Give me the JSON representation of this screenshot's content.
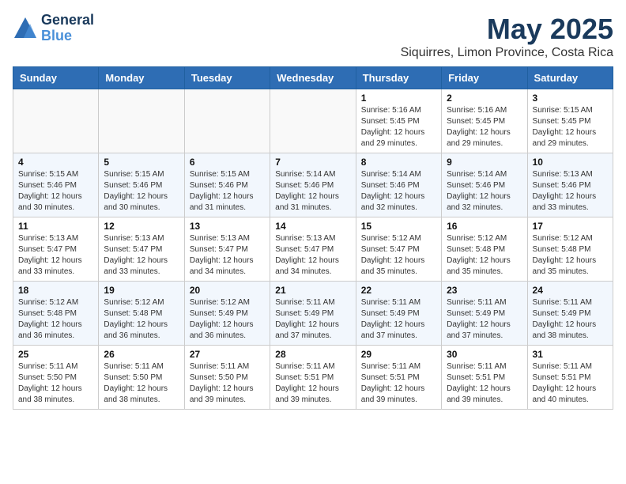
{
  "header": {
    "logo_general": "General",
    "logo_blue": "Blue",
    "month_title": "May 2025",
    "location": "Siquirres, Limon Province, Costa Rica"
  },
  "weekdays": [
    "Sunday",
    "Monday",
    "Tuesday",
    "Wednesday",
    "Thursday",
    "Friday",
    "Saturday"
  ],
  "weeks": [
    [
      {
        "day": "",
        "sunrise": "",
        "sunset": "",
        "daylight": ""
      },
      {
        "day": "",
        "sunrise": "",
        "sunset": "",
        "daylight": ""
      },
      {
        "day": "",
        "sunrise": "",
        "sunset": "",
        "daylight": ""
      },
      {
        "day": "",
        "sunrise": "",
        "sunset": "",
        "daylight": ""
      },
      {
        "day": "1",
        "sunrise": "Sunrise: 5:16 AM",
        "sunset": "Sunset: 5:45 PM",
        "daylight": "Daylight: 12 hours and 29 minutes."
      },
      {
        "day": "2",
        "sunrise": "Sunrise: 5:16 AM",
        "sunset": "Sunset: 5:45 PM",
        "daylight": "Daylight: 12 hours and 29 minutes."
      },
      {
        "day": "3",
        "sunrise": "Sunrise: 5:15 AM",
        "sunset": "Sunset: 5:45 PM",
        "daylight": "Daylight: 12 hours and 29 minutes."
      }
    ],
    [
      {
        "day": "4",
        "sunrise": "Sunrise: 5:15 AM",
        "sunset": "Sunset: 5:46 PM",
        "daylight": "Daylight: 12 hours and 30 minutes."
      },
      {
        "day": "5",
        "sunrise": "Sunrise: 5:15 AM",
        "sunset": "Sunset: 5:46 PM",
        "daylight": "Daylight: 12 hours and 30 minutes."
      },
      {
        "day": "6",
        "sunrise": "Sunrise: 5:15 AM",
        "sunset": "Sunset: 5:46 PM",
        "daylight": "Daylight: 12 hours and 31 minutes."
      },
      {
        "day": "7",
        "sunrise": "Sunrise: 5:14 AM",
        "sunset": "Sunset: 5:46 PM",
        "daylight": "Daylight: 12 hours and 31 minutes."
      },
      {
        "day": "8",
        "sunrise": "Sunrise: 5:14 AM",
        "sunset": "Sunset: 5:46 PM",
        "daylight": "Daylight: 12 hours and 32 minutes."
      },
      {
        "day": "9",
        "sunrise": "Sunrise: 5:14 AM",
        "sunset": "Sunset: 5:46 PM",
        "daylight": "Daylight: 12 hours and 32 minutes."
      },
      {
        "day": "10",
        "sunrise": "Sunrise: 5:13 AM",
        "sunset": "Sunset: 5:46 PM",
        "daylight": "Daylight: 12 hours and 33 minutes."
      }
    ],
    [
      {
        "day": "11",
        "sunrise": "Sunrise: 5:13 AM",
        "sunset": "Sunset: 5:47 PM",
        "daylight": "Daylight: 12 hours and 33 minutes."
      },
      {
        "day": "12",
        "sunrise": "Sunrise: 5:13 AM",
        "sunset": "Sunset: 5:47 PM",
        "daylight": "Daylight: 12 hours and 33 minutes."
      },
      {
        "day": "13",
        "sunrise": "Sunrise: 5:13 AM",
        "sunset": "Sunset: 5:47 PM",
        "daylight": "Daylight: 12 hours and 34 minutes."
      },
      {
        "day": "14",
        "sunrise": "Sunrise: 5:13 AM",
        "sunset": "Sunset: 5:47 PM",
        "daylight": "Daylight: 12 hours and 34 minutes."
      },
      {
        "day": "15",
        "sunrise": "Sunrise: 5:12 AM",
        "sunset": "Sunset: 5:47 PM",
        "daylight": "Daylight: 12 hours and 35 minutes."
      },
      {
        "day": "16",
        "sunrise": "Sunrise: 5:12 AM",
        "sunset": "Sunset: 5:48 PM",
        "daylight": "Daylight: 12 hours and 35 minutes."
      },
      {
        "day": "17",
        "sunrise": "Sunrise: 5:12 AM",
        "sunset": "Sunset: 5:48 PM",
        "daylight": "Daylight: 12 hours and 35 minutes."
      }
    ],
    [
      {
        "day": "18",
        "sunrise": "Sunrise: 5:12 AM",
        "sunset": "Sunset: 5:48 PM",
        "daylight": "Daylight: 12 hours and 36 minutes."
      },
      {
        "day": "19",
        "sunrise": "Sunrise: 5:12 AM",
        "sunset": "Sunset: 5:48 PM",
        "daylight": "Daylight: 12 hours and 36 minutes."
      },
      {
        "day": "20",
        "sunrise": "Sunrise: 5:12 AM",
        "sunset": "Sunset: 5:49 PM",
        "daylight": "Daylight: 12 hours and 36 minutes."
      },
      {
        "day": "21",
        "sunrise": "Sunrise: 5:11 AM",
        "sunset": "Sunset: 5:49 PM",
        "daylight": "Daylight: 12 hours and 37 minutes."
      },
      {
        "day": "22",
        "sunrise": "Sunrise: 5:11 AM",
        "sunset": "Sunset: 5:49 PM",
        "daylight": "Daylight: 12 hours and 37 minutes."
      },
      {
        "day": "23",
        "sunrise": "Sunrise: 5:11 AM",
        "sunset": "Sunset: 5:49 PM",
        "daylight": "Daylight: 12 hours and 37 minutes."
      },
      {
        "day": "24",
        "sunrise": "Sunrise: 5:11 AM",
        "sunset": "Sunset: 5:49 PM",
        "daylight": "Daylight: 12 hours and 38 minutes."
      }
    ],
    [
      {
        "day": "25",
        "sunrise": "Sunrise: 5:11 AM",
        "sunset": "Sunset: 5:50 PM",
        "daylight": "Daylight: 12 hours and 38 minutes."
      },
      {
        "day": "26",
        "sunrise": "Sunrise: 5:11 AM",
        "sunset": "Sunset: 5:50 PM",
        "daylight": "Daylight: 12 hours and 38 minutes."
      },
      {
        "day": "27",
        "sunrise": "Sunrise: 5:11 AM",
        "sunset": "Sunset: 5:50 PM",
        "daylight": "Daylight: 12 hours and 39 minutes."
      },
      {
        "day": "28",
        "sunrise": "Sunrise: 5:11 AM",
        "sunset": "Sunset: 5:51 PM",
        "daylight": "Daylight: 12 hours and 39 minutes."
      },
      {
        "day": "29",
        "sunrise": "Sunrise: 5:11 AM",
        "sunset": "Sunset: 5:51 PM",
        "daylight": "Daylight: 12 hours and 39 minutes."
      },
      {
        "day": "30",
        "sunrise": "Sunrise: 5:11 AM",
        "sunset": "Sunset: 5:51 PM",
        "daylight": "Daylight: 12 hours and 39 minutes."
      },
      {
        "day": "31",
        "sunrise": "Sunrise: 5:11 AM",
        "sunset": "Sunset: 5:51 PM",
        "daylight": "Daylight: 12 hours and 40 minutes."
      }
    ]
  ]
}
